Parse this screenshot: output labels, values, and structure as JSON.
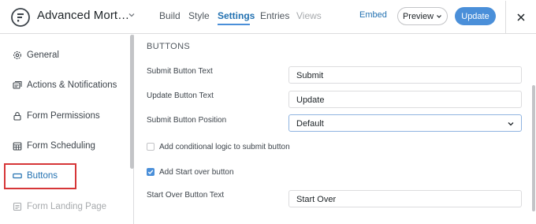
{
  "header": {
    "form_title": "Advanced Mort…",
    "tabs": [
      {
        "label": "Build"
      },
      {
        "label": "Style"
      },
      {
        "label": "Settings"
      },
      {
        "label": "Entries"
      },
      {
        "label": "Views"
      }
    ],
    "active_tab": "Settings",
    "embed_label": "Embed",
    "preview_label": "Preview",
    "update_label": "Update",
    "accent_color": "#4a8fd9"
  },
  "sidebar": {
    "items": [
      {
        "label": "General",
        "icon": "gear-icon"
      },
      {
        "label": "Actions & Notifications",
        "icon": "notifications-icon"
      },
      {
        "label": "Form Permissions",
        "icon": "lock-icon"
      },
      {
        "label": "Form Scheduling",
        "icon": "calendar-icon"
      },
      {
        "label": "Buttons",
        "icon": "button-icon"
      },
      {
        "label": "Form Landing Page",
        "icon": "landing-page-icon"
      }
    ],
    "selected": "Buttons",
    "highlight_color": "#d63638"
  },
  "main": {
    "section_title": "BUTTONS",
    "submit_text": {
      "label": "Submit Button Text",
      "value": "Submit"
    },
    "update_text": {
      "label": "Update Button Text",
      "value": "Update"
    },
    "submit_position": {
      "label": "Submit Button Position",
      "value": "Default"
    },
    "conditional_logic": {
      "label": "Add conditional logic to submit button",
      "checked": false
    },
    "start_over": {
      "label": "Add Start over button",
      "checked": true
    },
    "start_over_text": {
      "label": "Start Over Button Text",
      "value": "Start Over"
    }
  }
}
